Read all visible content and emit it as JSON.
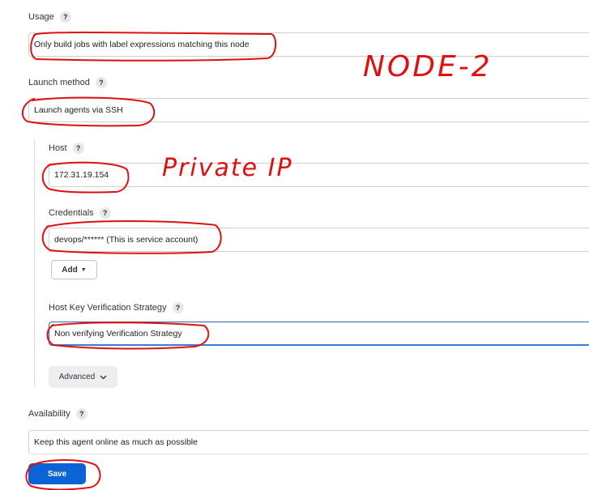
{
  "usage": {
    "label": "Usage",
    "value": "Only build jobs with label expressions matching this node"
  },
  "launch_method": {
    "label": "Launch method",
    "value": "Launch agents via SSH"
  },
  "host": {
    "label": "Host",
    "value": "172.31.19.154"
  },
  "credentials": {
    "label": "Credentials",
    "value": "devops/****** (This is service account)",
    "add_label": "Add"
  },
  "host_key": {
    "label": "Host Key Verification Strategy",
    "value": "Non verifying Verification Strategy"
  },
  "advanced_label": "Advanced",
  "availability": {
    "label": "Availability",
    "value": "Keep this agent online as much as possible"
  },
  "save_label": "Save",
  "help_glyph": "?",
  "annotations": {
    "node_note": "NODE-2",
    "ip_note": "Private IP"
  },
  "colors": {
    "annotation": "#e01010",
    "primary_button": "#0b63d6",
    "focus_border": "#3a7bd5"
  }
}
